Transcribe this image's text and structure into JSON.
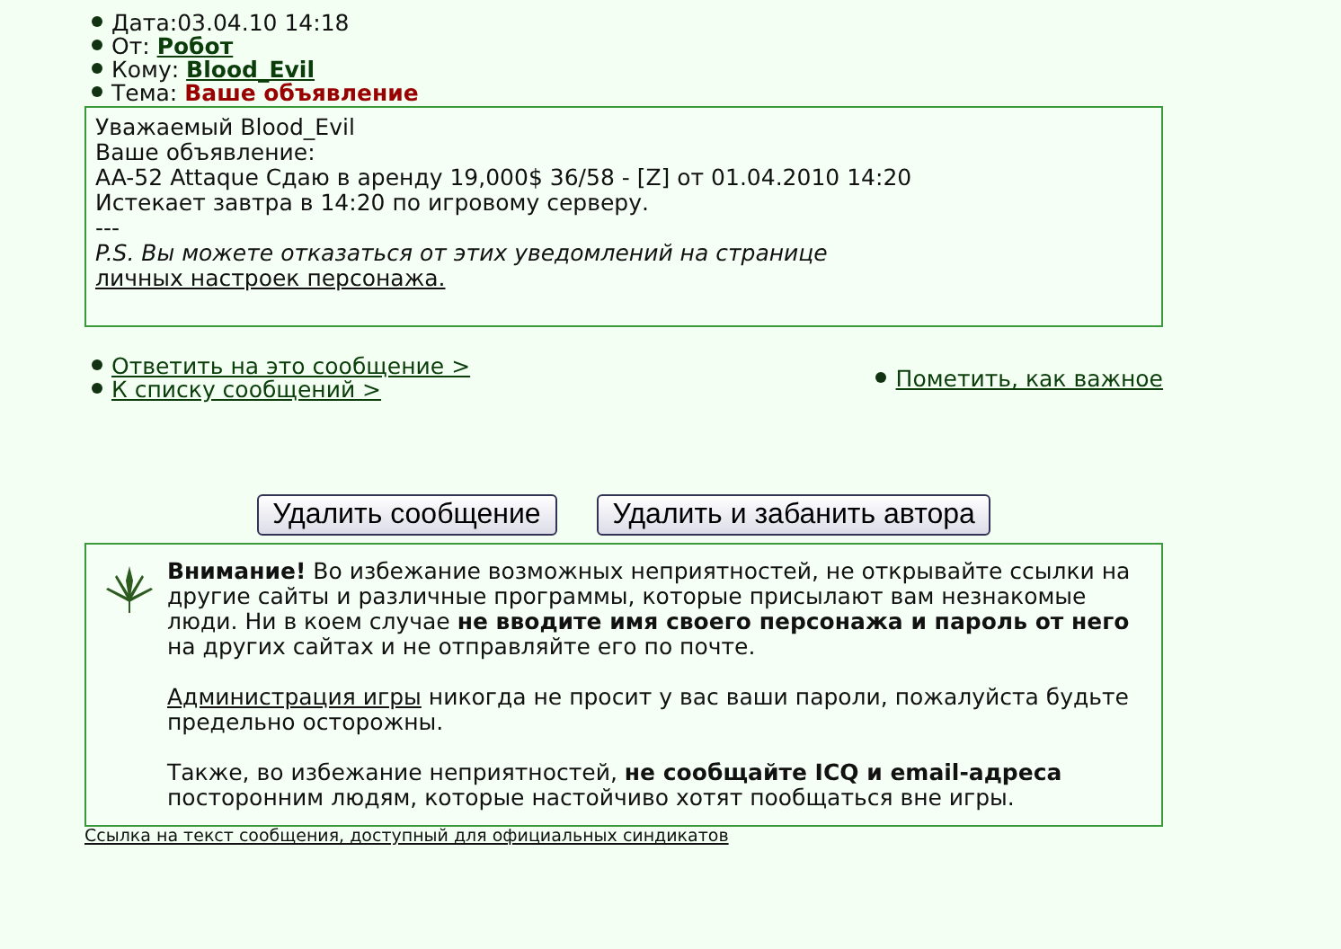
{
  "header": [
    {
      "label": "Дата:",
      "value": "03.04.10 14:18",
      "kind": "plain"
    },
    {
      "label": "От: ",
      "value": "Робот",
      "kind": "link"
    },
    {
      "label": "Кому: ",
      "value": "Blood_Evil",
      "kind": "link"
    },
    {
      "label": "Тема: ",
      "value": "Ваше объявление",
      "kind": "subject"
    }
  ],
  "message": {
    "lines": [
      "Уважаемый Blood_Evil",
      "Ваше объявление:",
      "AA-52 Attaque Сдаю в аренду 19,000$ 36/58 - [Z] от 01.04.2010 14:20",
      "Истекает завтра в 14:20 по игровому серверу.",
      "---"
    ],
    "ps": {
      "text": "P.S. Вы можете отказаться от этих уведомлений на странице",
      "link": "личных настроек персонажа."
    }
  },
  "actions_left": [
    "Ответить на это сообщение >",
    "К списку сообщений >"
  ],
  "actions_right": [
    "Пометить, как важное"
  ],
  "buttons": [
    "Удалить сообщение",
    "Удалить и забанить автора"
  ],
  "warning": {
    "paragraphs": [
      {
        "kind": "text",
        "text": "**Внимание!** Во избежание возможных неприятностей, не открывайте ссылки на другие сайты и различные программы, которые присылают вам незнакомые люди. Ни в коем случае **не вводите имя своего персонажа и пароль от него** на других сайтах и не отправляйте его по почте."
      },
      {
        "kind": "link_lead",
        "link": "Администрация игры",
        "text": "никогда не просит у вас ваши пароли, пожалуйста будьте предельно осторожны."
      },
      {
        "kind": "text",
        "text": "Также, во избежание неприятностей, **не сообщайте ICQ и email-адреса** посторонним людям, которые настойчиво хотят пообщаться вне игры."
      }
    ]
  },
  "footer_link": "Ссылка на текст сообщения, доступный для официальных синдикатов"
}
